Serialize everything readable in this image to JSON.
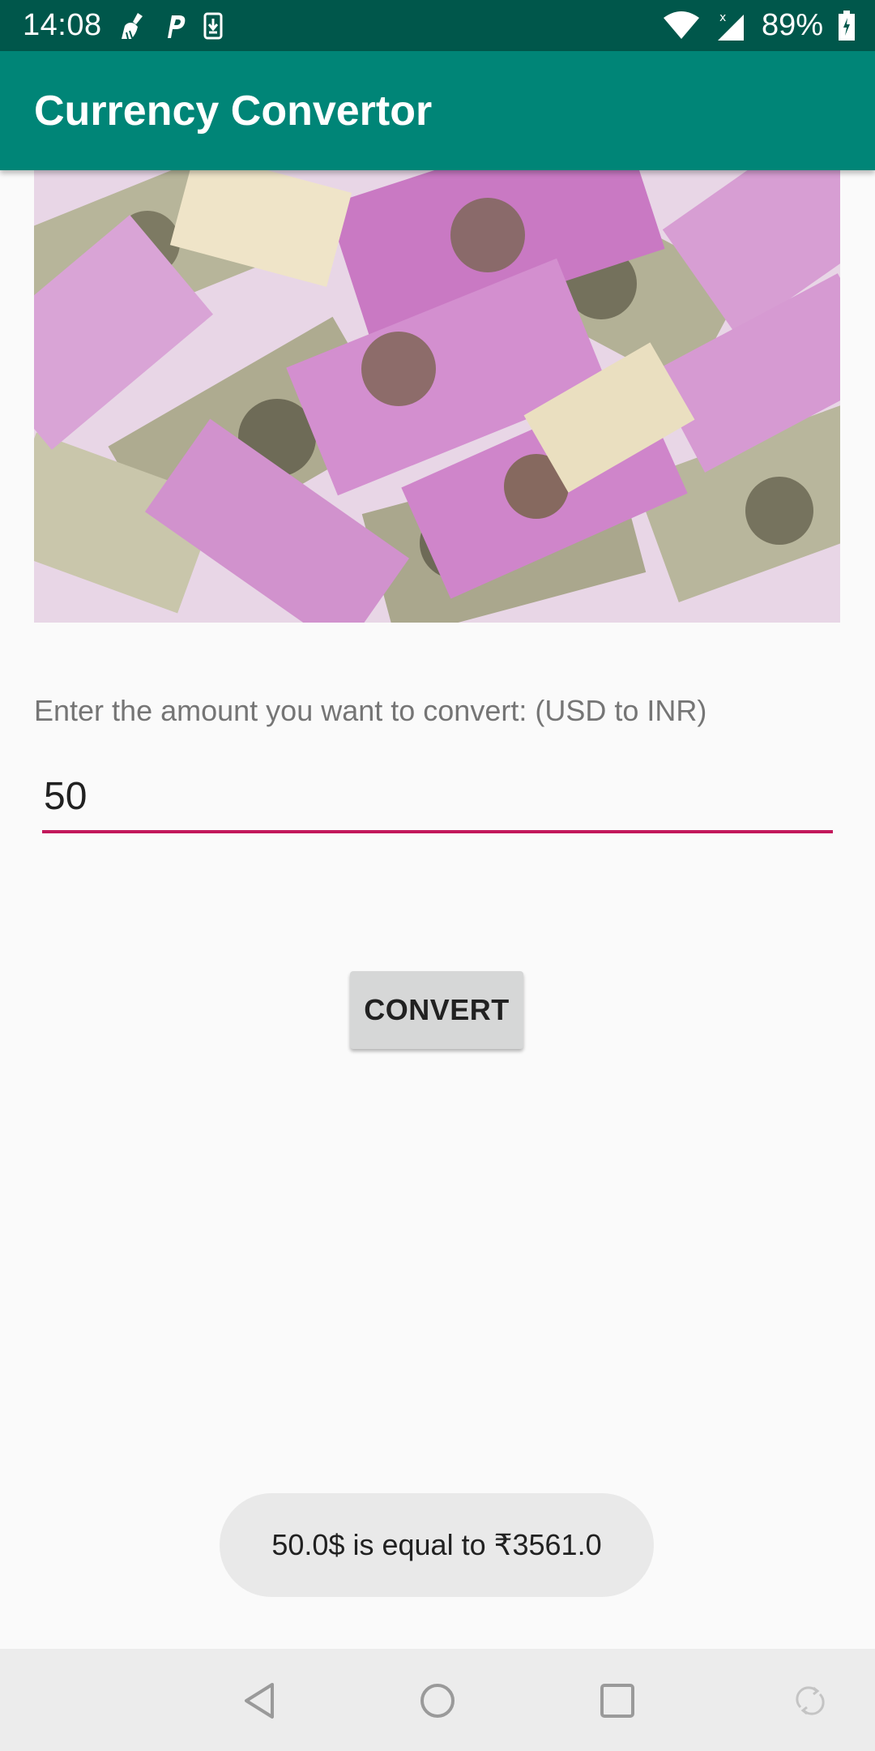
{
  "status_bar": {
    "time": "14:08",
    "battery": "89%",
    "icons": [
      "broom-icon",
      "parking-p-icon",
      "download-phone-icon",
      "wifi-icon",
      "cell-signal-icon",
      "battery-icon"
    ]
  },
  "app_bar": {
    "title": "Currency Convertor"
  },
  "banner": {
    "icon": "indian-rupee-notes-image"
  },
  "form": {
    "prompt": "Enter the amount you want to convert: (USD to INR)",
    "amount_value": "50",
    "convert_label": "CONVERT"
  },
  "toast": {
    "message": "50.0$ is equal to ₹3561.0"
  },
  "nav_bar": {
    "icons": [
      "back-icon",
      "home-icon",
      "recents-icon",
      "rotate-icon"
    ]
  },
  "colors": {
    "status_bar": "#00574b",
    "app_bar": "#008577",
    "accent": "#c2185b",
    "button": "#d6d7d7",
    "note_pink": "#c86fc4",
    "note_olive": "#a8a686"
  }
}
